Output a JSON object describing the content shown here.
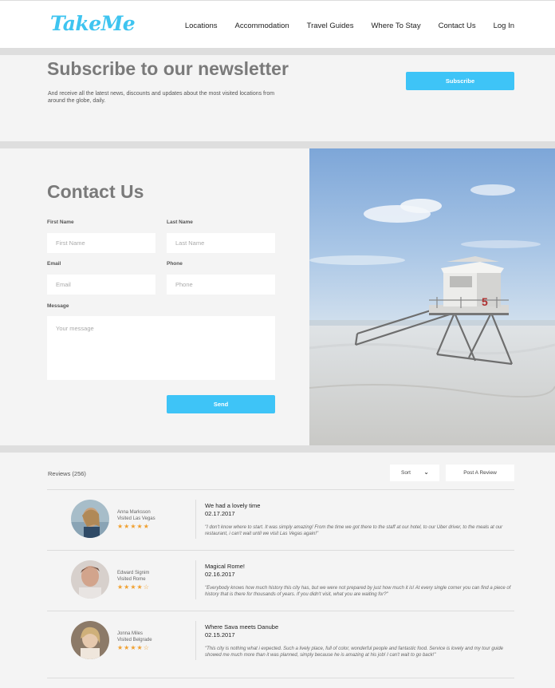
{
  "header": {
    "logo": "TakeMe",
    "nav": [
      "Locations",
      "Accommodation",
      "Travel Guides",
      "Where To Stay",
      "Contact Us",
      "Log In"
    ]
  },
  "newsletter": {
    "title": "Subscribe to our newsletter",
    "description": "And receive all the latest news, discounts and updates about the most visited locations from around the globe, daily.",
    "button": "Subscribe"
  },
  "contact": {
    "title": "Contact Us",
    "first_name_label": "First Name",
    "first_name_placeholder": "First Name",
    "last_name_label": "Last Name",
    "last_name_placeholder": "Last Name",
    "email_label": "Email",
    "email_placeholder": "Email",
    "phone_label": "Phone",
    "phone_placeholder": "Phone",
    "message_label": "Message",
    "message_placeholder": "Your message",
    "send": "Send"
  },
  "beach_image": {
    "tower_number": "5"
  },
  "reviews": {
    "count_label": "Reviews (256)",
    "sort_label": "Sort",
    "post_label": "Post A Review",
    "items": [
      {
        "name": "Anna Marksson",
        "visited": "Visited Las Vegas",
        "rating": 5,
        "stars": "★★★★★",
        "title": "We had a lovely time",
        "date": "02.17.2017",
        "text": "\"I don't know where to start. It was simply amazing! From the time we got there to the staff at our hotel, to our Uber driver, to the meals at our restaurant, i can't wait until we visit Las Vegas again!\""
      },
      {
        "name": "Edward Signim",
        "visited": "Visited Rome",
        "rating": 4,
        "stars": "★★★★☆",
        "title": "Magical Rome!",
        "date": "02.16.2017",
        "text": "\"Everybody knows how much history this city has, but we were not prepared by just how much it is! At every single corner you can find a piece of history that is there for thousands of years. If you didn't visit, what you are waiting for?\""
      },
      {
        "name": "Jonna Miles",
        "visited": "Visited Belgrade",
        "rating": 4,
        "stars": "★★★★☆",
        "title": "Where Sava meets Danube",
        "date": "02.15.2017",
        "text": "\"This city is nothing what i expected. Such a lively place, full of color, wonderful people and fantastic food. Service is lovely and my tour guide showed me much more than it was planned, simply because he is amazing at his job! I can't wait to go back!\""
      }
    ]
  },
  "colors": {
    "accent": "#3ec4f7",
    "star": "#f0a030",
    "heading": "#7a7a7a"
  }
}
